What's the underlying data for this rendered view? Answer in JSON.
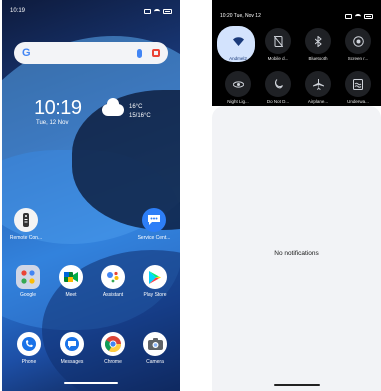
{
  "left_screen": {
    "status_bar": {
      "time": "10:19"
    },
    "search": {
      "logo": "G",
      "mic_icon": "mic-icon",
      "lens_icon": "lens-icon"
    },
    "clock": {
      "time": "10:19",
      "date": "Tue, 12 Nov"
    },
    "weather": {
      "icon": "cloud-icon",
      "temp": "16°C",
      "range": "15/16°C"
    },
    "apps_row1": [
      {
        "label": "Remote Con...",
        "icon": "remote-icon",
        "color": "#ffffff"
      },
      {
        "label": "Service Cent...",
        "icon": "chat-bubble-icon",
        "color": "#2d7ef7"
      }
    ],
    "apps_row2": [
      {
        "label": "Google",
        "icon": "folder-icon",
        "color": "#cfd6e6"
      },
      {
        "label": "Meet",
        "icon": "meet-icon",
        "color": "#ffffff"
      },
      {
        "label": "Assistant",
        "icon": "assistant-icon",
        "color": "#ffffff"
      },
      {
        "label": "Play Store",
        "icon": "play-store-icon",
        "color": "#ffffff"
      }
    ],
    "dock": [
      {
        "label": "Phone",
        "icon": "phone-icon",
        "color": "#ffffff"
      },
      {
        "label": "Messages",
        "icon": "messages-icon",
        "color": "#ffffff"
      },
      {
        "label": "Chrome",
        "icon": "chrome-icon",
        "color": "#ffffff"
      },
      {
        "label": "Camera",
        "icon": "camera-icon",
        "color": "#ffffff"
      }
    ]
  },
  "right_screen": {
    "status_bar": {
      "datetime": "10:20 Tue, Nov 12"
    },
    "tiles": [
      {
        "label": "Andmel2",
        "icon": "wifi-icon",
        "active": true
      },
      {
        "label": "Mobile d...",
        "icon": "mobile-data-icon",
        "active": false
      },
      {
        "label": "Bluetooth",
        "icon": "bluetooth-icon",
        "active": false
      },
      {
        "label": "Screen r...",
        "icon": "screen-record-icon",
        "active": false
      },
      {
        "label": "Night Lig...",
        "icon": "eye-icon",
        "active": false
      },
      {
        "label": "Do Not D...",
        "icon": "moon-icon",
        "active": false
      },
      {
        "label": "Airplane...",
        "icon": "airplane-icon",
        "active": false
      },
      {
        "label": "Underwa...",
        "icon": "underwater-icon",
        "active": false
      }
    ],
    "notifications": {
      "empty_text": "No notifications"
    }
  },
  "colors": {
    "accent": "#d3e3fd",
    "shade": "#000000",
    "panel": "#f2f3f6"
  }
}
